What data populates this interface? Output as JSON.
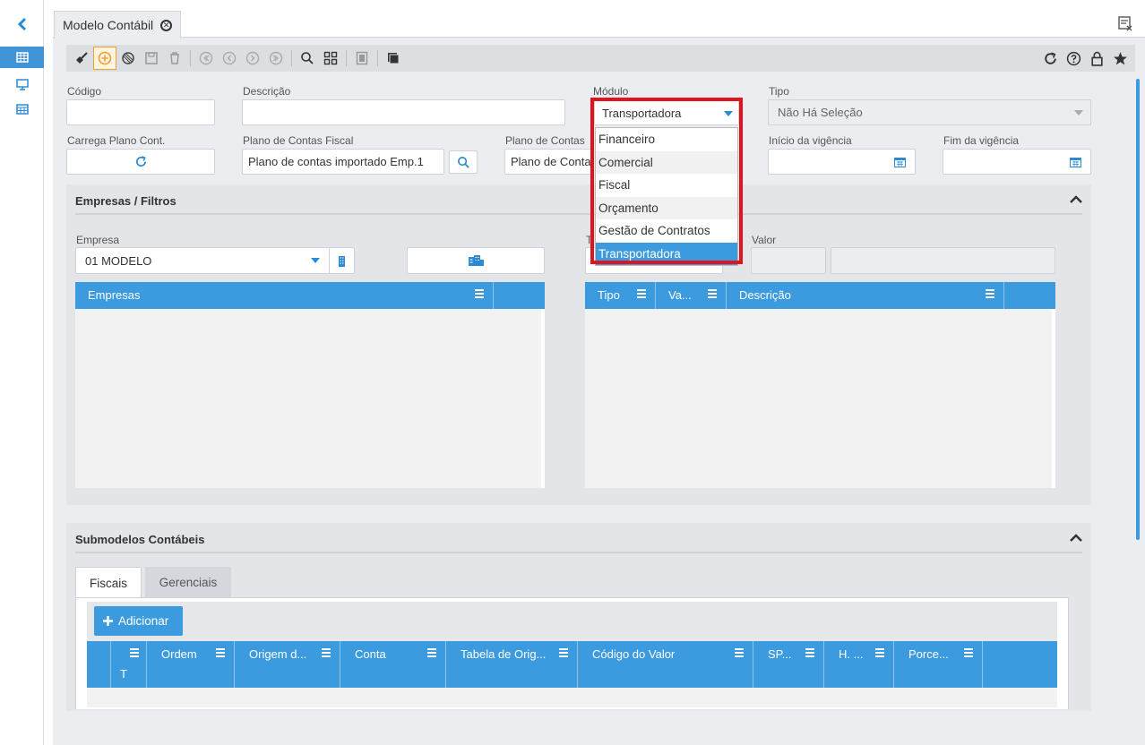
{
  "window": {
    "tab_title": "Modelo Contábil"
  },
  "toolbar": {
    "left_icons": [
      "broom-icon",
      "add-circle-icon",
      "cancel-icon",
      "save-icon",
      "trash-icon",
      "first-icon",
      "prev-icon",
      "next-icon",
      "last-icon",
      "search-icon",
      "grid-icon",
      "form-icon",
      "layers-icon"
    ],
    "right_icons": [
      "refresh-icon",
      "help-icon",
      "lock-icon",
      "star-icon"
    ]
  },
  "form": {
    "codigo_label": "Código",
    "codigo_value": "",
    "descricao_label": "Descrição",
    "descricao_value": "",
    "modulo_label": "Módulo",
    "modulo_value": "Transportadora",
    "tipo_label": "Tipo",
    "tipo_value": "Não Há Seleção",
    "carrega_label": "Carrega Plano Cont.",
    "plano_fiscal_label": "Plano de Contas Fiscal",
    "plano_fiscal_value": "Plano de contas importado Emp.1",
    "plano_contas_label": "Plano de Contas",
    "plano_contas_value": "Plano de Contas",
    "inicio_label": "Início da vigência",
    "inicio_value": "",
    "fim_label": "Fim da vigência",
    "fim_value": ""
  },
  "dropdown": {
    "options": [
      "Financeiro",
      "Comercial",
      "Fiscal",
      "Orçamento",
      "Gestão de Contratos",
      "Transportadora"
    ],
    "selected": "Transportadora"
  },
  "empresas_panel": {
    "title": "Empresas / Filtros",
    "empresa_label": "Empresa",
    "empresa_value": "01 MODELO",
    "t_label": "T",
    "valor_label": "Valor",
    "grid_left_headers": [
      "Empresas"
    ],
    "grid_right_headers": [
      "Tipo",
      "Va...",
      "Descrição"
    ]
  },
  "submodelos_panel": {
    "title": "Submodelos Contábeis",
    "tabs": [
      "Fiscais",
      "Gerenciais"
    ],
    "active_tab": "Fiscais",
    "add_button": "Adicionar",
    "grid_headers": [
      "T",
      "Ordem",
      "Origem d...",
      "Conta",
      "Tabela de Orig...",
      "Código do Valor",
      "SP...",
      "H. ...",
      "Porce..."
    ]
  },
  "colors": {
    "accent": "#3c9ade",
    "highlight": "#e0141e",
    "add_border": "#f0a030"
  }
}
